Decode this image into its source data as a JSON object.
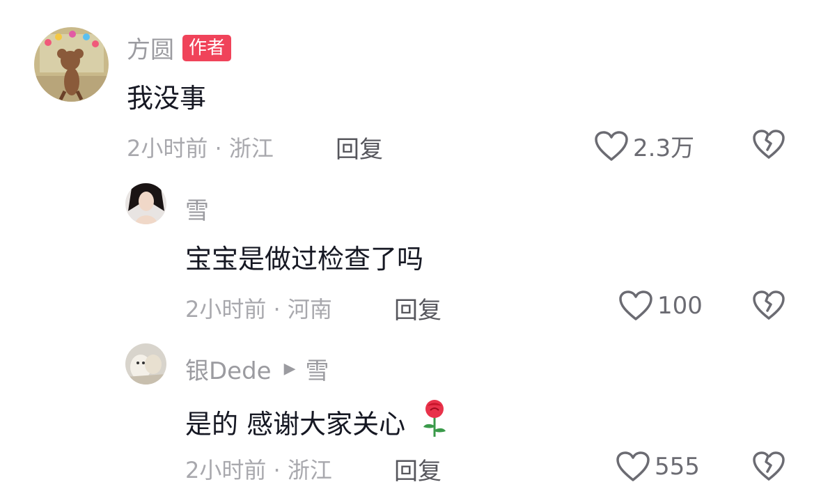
{
  "comments": [
    {
      "author": "方圆",
      "badge": "作者",
      "text": "我没事",
      "time": "2小时前",
      "location": "浙江",
      "meta_sep": " · ",
      "reply_label": "回复",
      "likes": "2.3万",
      "avatar_icon": "cartoon-mouse-avatar"
    },
    {
      "author": "雪",
      "text": "宝宝是做过检查了吗",
      "time": "2小时前",
      "location": "河南",
      "meta_sep": " · ",
      "reply_label": "回复",
      "likes": "100",
      "avatar_icon": "girl-photo-avatar"
    },
    {
      "author": "银Dede",
      "reply_to": "雪",
      "text": "是的 感谢大家关心",
      "emoji": "rose-emoji",
      "time": "2小时前",
      "location": "浙江",
      "meta_sep": " · ",
      "reply_label": "回复",
      "likes": "555",
      "avatar_icon": "cat-photo-avatar"
    }
  ],
  "colors": {
    "badge": "#f0435a",
    "name": "#9b9ba0",
    "text": "#161823",
    "meta": "#a8a8ad"
  }
}
